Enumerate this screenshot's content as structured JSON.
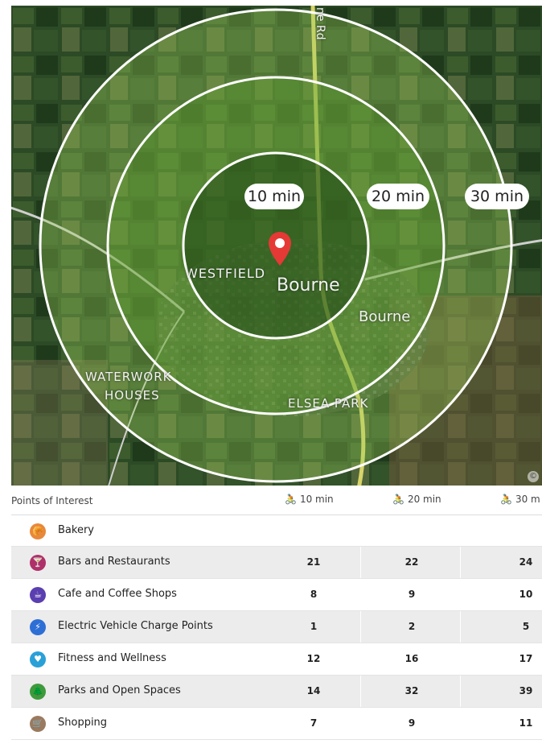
{
  "map": {
    "rings": [
      {
        "label": "10 min"
      },
      {
        "label": "20 min"
      },
      {
        "label": "30 min"
      }
    ],
    "labels": {
      "road": "ne Rd",
      "westfield": "WESTFIELD",
      "bourne_main": "Bourne",
      "bourne_secondary": "Bourne",
      "waterwork_line1": "WATERWORK",
      "waterwork_line2": "HOUSES",
      "elsea_park": "ELSEA PARK"
    },
    "copyright_symbol": "©"
  },
  "poi": {
    "title": "Points of Interest",
    "columns": [
      "10 min",
      "20 min",
      "30 m"
    ],
    "rows": [
      {
        "name": "Bakery",
        "icon": "bakery-icon",
        "color": "#e8883a",
        "v10": "",
        "v20": "",
        "v30": ""
      },
      {
        "name": "Bars and Restaurants",
        "icon": "cocktail-icon",
        "color": "#b0306a",
        "v10": "21",
        "v20": "22",
        "v30": "24"
      },
      {
        "name": "Cafe and Coffee Shops",
        "icon": "coffee-cup-icon",
        "color": "#5a3fb0",
        "v10": "8",
        "v20": "9",
        "v30": "10"
      },
      {
        "name": "Electric Vehicle Charge Points",
        "icon": "ev-charge-icon",
        "color": "#2e6fd6",
        "v10": "1",
        "v20": "2",
        "v30": "5"
      },
      {
        "name": "Fitness and Wellness",
        "icon": "heart-icon",
        "color": "#2aa0d8",
        "v10": "12",
        "v20": "16",
        "v30": "17"
      },
      {
        "name": "Parks and Open Spaces",
        "icon": "tree-icon",
        "color": "#3f9a3c",
        "v10": "14",
        "v20": "32",
        "v30": "39"
      },
      {
        "name": "Shopping",
        "icon": "shopping-cart-icon",
        "color": "#9a7a5e",
        "v10": "7",
        "v20": "9",
        "v30": "11"
      }
    ]
  }
}
